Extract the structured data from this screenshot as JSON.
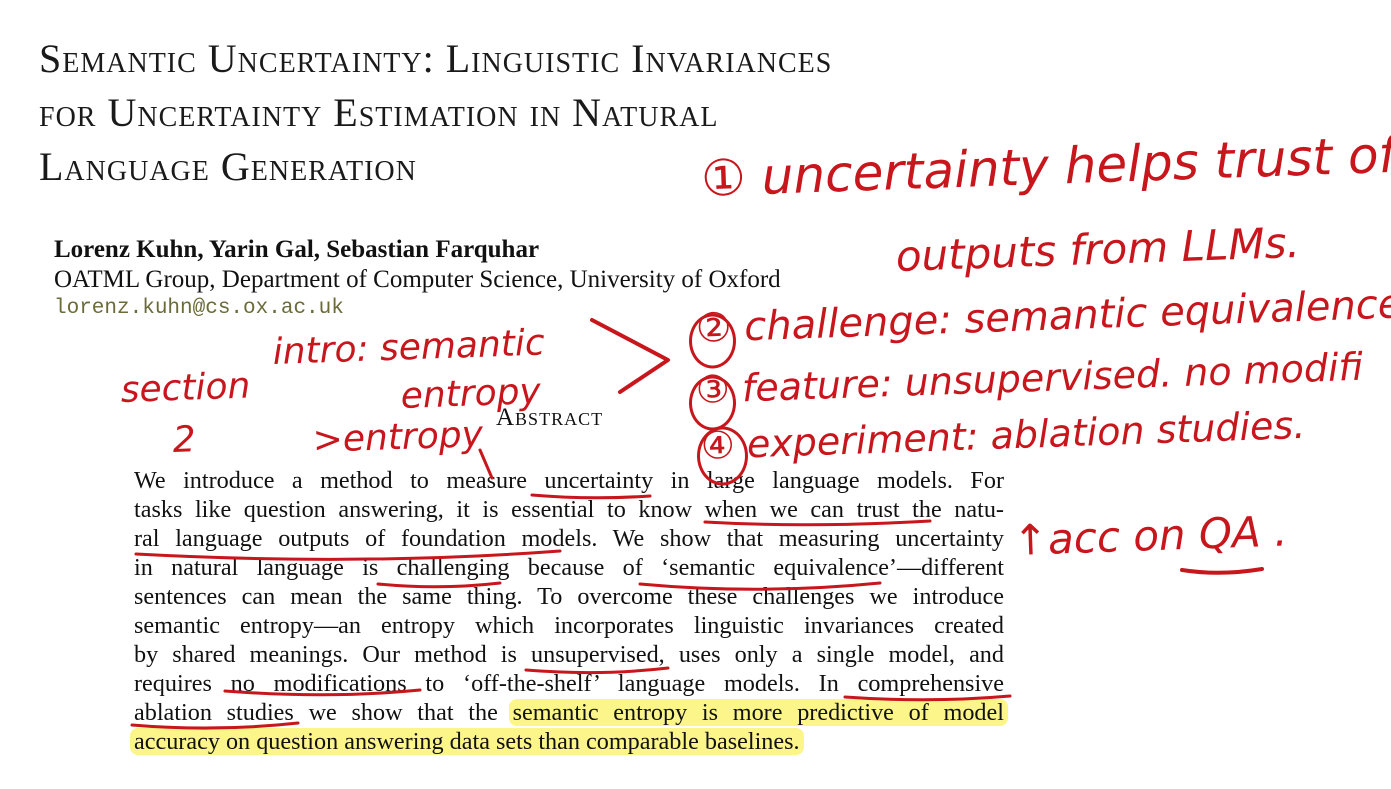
{
  "paper": {
    "title_lines": [
      "Semantic Uncertainty: Linguistic Invariances",
      "for Uncertainty Estimation in Natural",
      "Language Generation"
    ],
    "authors": "Lorenz Kuhn, Yarin Gal, Sebastian Farquhar",
    "affiliation": "OATML Group, Department of Computer Science, University of Oxford",
    "email": "lorenz.kuhn@cs.ox.ac.uk",
    "abstract_heading": "Abstract",
    "abstract_lines": [
      "We introduce a method to measure uncertainty in large language models. For",
      "tasks like question answering, it is essential to know when we can trust the natu-",
      "ral language outputs of foundation models. We show that measuring uncertainty",
      "in natural language is challenging because of ‘semantic equivalence’—different",
      "sentences can mean the same thing. To overcome these challenges we introduce",
      "semantic entropy—an entropy which incorporates linguistic invariances created",
      "by shared meanings. Our method is unsupervised, uses only a single model, and",
      "requires no modifications to ‘off-the-shelf’ language models. In comprehensive"
    ],
    "abstract_line9_plain": "ablation studies we show that the ",
    "abstract_line9_highlight": "semantic entropy is more predictive of model",
    "abstract_line10_highlight": "accuracy on question answering data sets than comparable baselines."
  },
  "annotations": {
    "note1": "① uncertainty helps trust of",
    "note1b": "outputs from LLMs.",
    "note2": "② challenge: semantic equivalence",
    "note3": "③ feature: unsupervised. no modifi",
    "note4": "④ experiment: ablation studies.",
    "note4b": "↑acc on QA .",
    "intro": "intro: semantic",
    "intro2": "entropy",
    "intro3": ">entropy",
    "section": "section",
    "section2": "2",
    "ink_color": "#c8161d",
    "highlight_color": "#fbf58a"
  }
}
